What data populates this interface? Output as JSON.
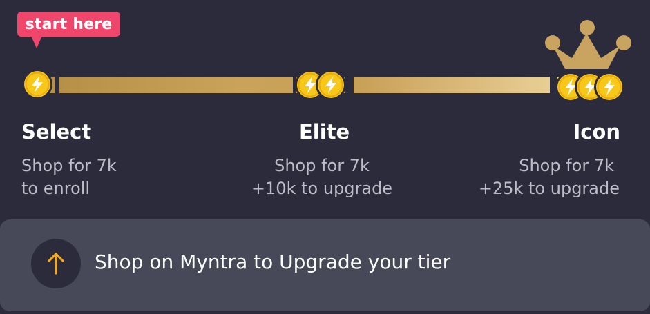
{
  "tooltip": {
    "text": "start here",
    "color": "#f1466b"
  },
  "colors": {
    "background": "#2b2b3b",
    "card": "#474858",
    "gold": "#f7c71a",
    "accent_arrow": "#f3a81e"
  },
  "tiers": [
    {
      "name": "Select",
      "line1": "Shop for 7k",
      "line2": "to enroll",
      "coins": 1
    },
    {
      "name": "Elite",
      "line1": "Shop for 7k",
      "line2": "+10k to upgrade",
      "coins": 2
    },
    {
      "name": "Icon",
      "line1": "Shop for 7k",
      "line2": "+25k to upgrade",
      "coins": 3,
      "crown": "crown-icon"
    }
  ],
  "cta": {
    "icon": "arrow-up-icon",
    "label": "Shop on Myntra to Upgrade your tier"
  }
}
